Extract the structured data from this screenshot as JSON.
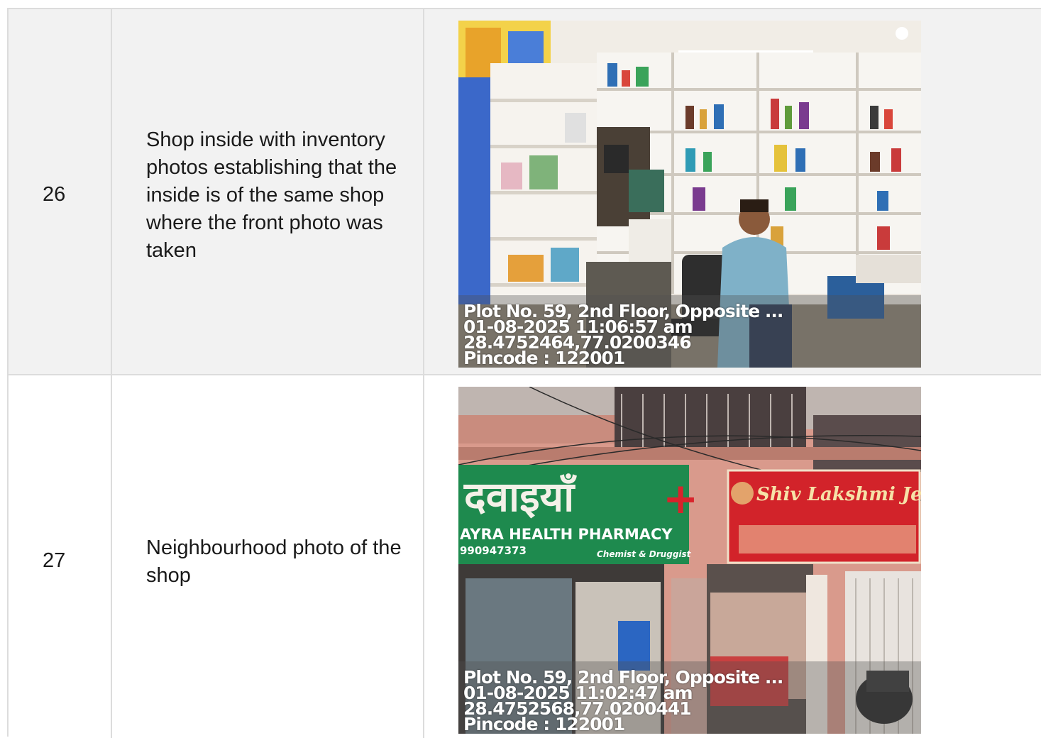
{
  "rows": [
    {
      "number": "26",
      "description": "Shop inside with inventory photos establishing that the inside is of the same shop where the front photo was taken",
      "photo": {
        "stamp": {
          "address": "Plot No. 59, 2nd Floor, Opposite ...",
          "datetime": "01-08-2025 11:06:57 am",
          "coords": "28.4752464,77.0200346",
          "pincode": "Pincode : 122001"
        }
      }
    },
    {
      "number": "27",
      "description": "Neighbourhood photo of the shop",
      "photo": {
        "signs": {
          "hindi": "दवाइयाँ",
          "pharmacy": "AYRA HEALTH PHARMACY",
          "phone": "990947373",
          "chemist": "Chemist & Druggist",
          "jewellers": "Shiv Lakshmi Jewellers"
        },
        "stamp": {
          "address": "Plot No. 59, 2nd Floor, Opposite ...",
          "datetime": "01-08-2025 11:02:47 am",
          "coords": "28.4752568,77.0200441",
          "pincode": "Pincode : 122001"
        }
      }
    }
  ]
}
